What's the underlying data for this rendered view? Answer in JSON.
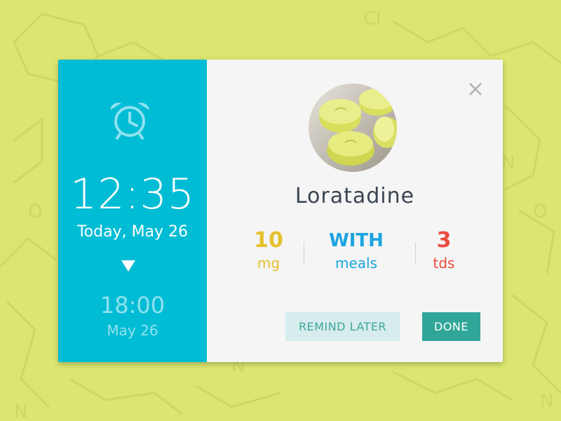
{
  "reminder": {
    "current_time": "12:35",
    "current_date": "Today, May 26",
    "next_time": "18:00",
    "next_date": "May 26"
  },
  "medication": {
    "name": "Loratadine",
    "image_icon": "pill-photo",
    "dose": {
      "value": "10",
      "unit": "mg"
    },
    "timing": {
      "value": "WITH",
      "unit": "meals"
    },
    "frequency": {
      "value": "3",
      "unit": "tds"
    }
  },
  "actions": {
    "remind_later_label": "REMIND LATER",
    "done_label": "DONE",
    "close_icon": "close-icon"
  },
  "background": {
    "chlorine_label": "Cl",
    "nitrogen_label": "N",
    "oxygen_label": "O"
  },
  "colors": {
    "background": "#dbe670",
    "panel": "#00bcd4",
    "dose": "#e5c12e",
    "timing": "#1ba5e0",
    "frequency": "#ee4b3e",
    "done": "#30a699"
  }
}
